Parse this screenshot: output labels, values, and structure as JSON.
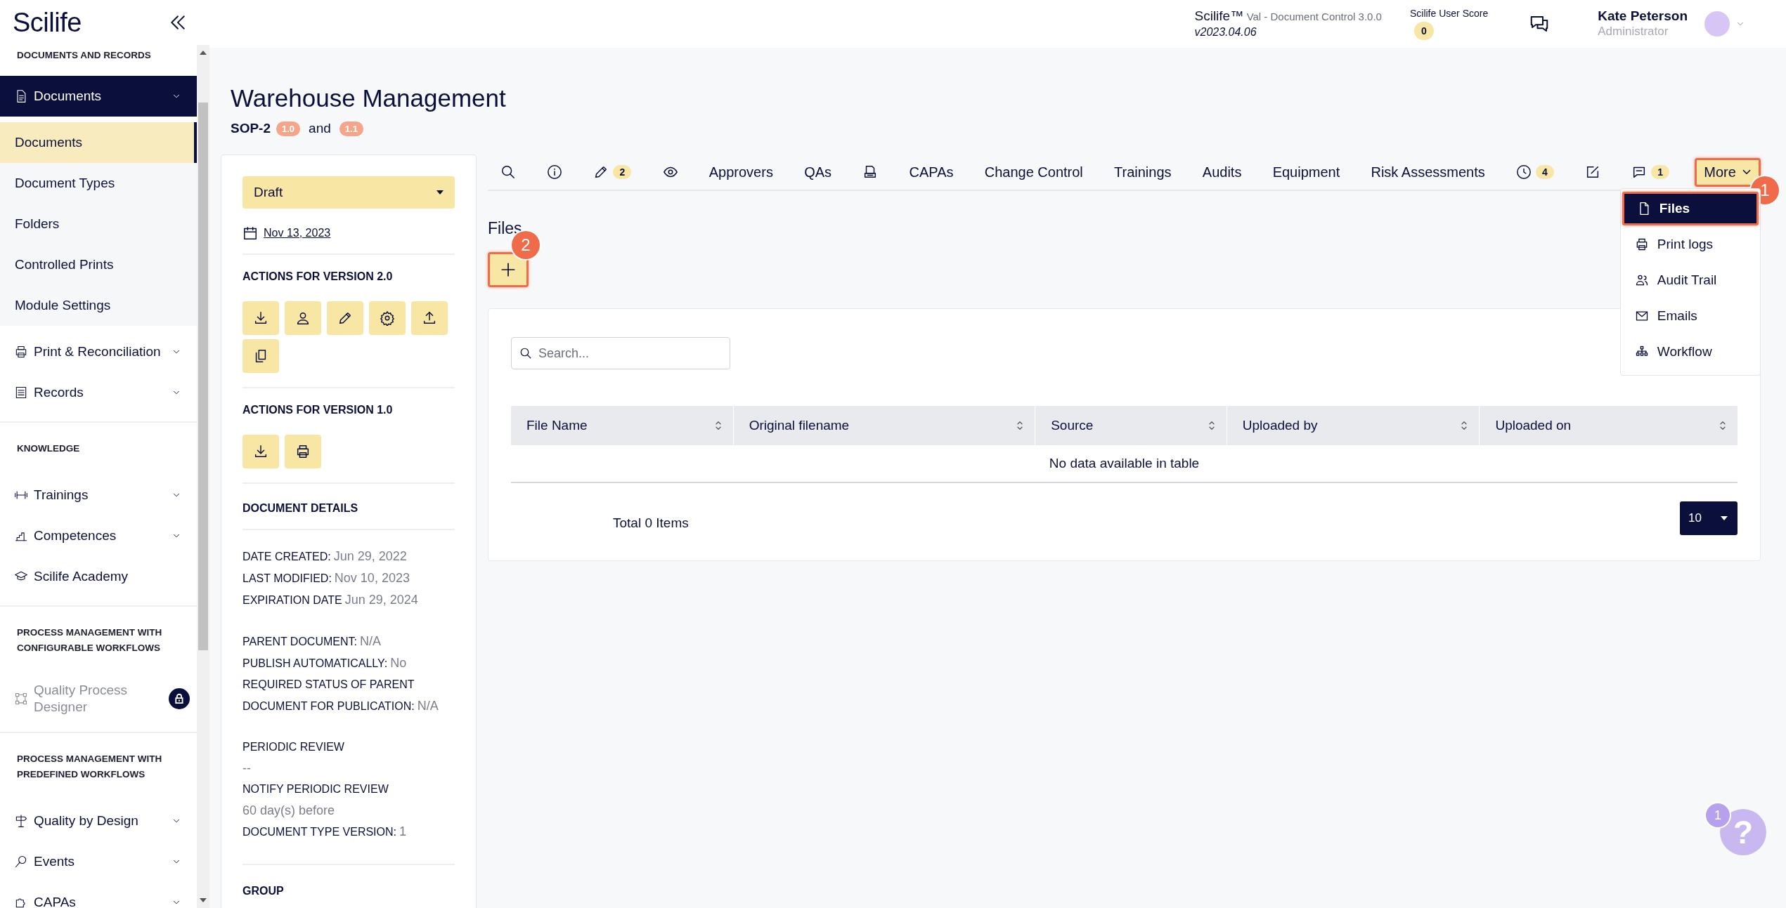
{
  "sidebar": {
    "logo": "Scilife",
    "sections": [
      {
        "title": "DOCUMENTS AND RECORDS",
        "items": [
          {
            "label": "Documents",
            "kind": "group",
            "expanded": true,
            "locked": false,
            "children": [
              {
                "label": "Documents",
                "selected": true
              },
              {
                "label": "Document Types",
                "selected": false
              },
              {
                "label": "Folders",
                "selected": false
              },
              {
                "label": "Controlled Prints",
                "selected": false
              },
              {
                "label": "Module Settings",
                "selected": false
              }
            ]
          },
          {
            "label": "Print & Reconciliation",
            "kind": "group",
            "expanded": false,
            "locked": false
          },
          {
            "label": "Records",
            "kind": "group",
            "expanded": false,
            "locked": false
          }
        ]
      },
      {
        "title": "KNOWLEDGE",
        "items": [
          {
            "label": "Trainings",
            "kind": "group",
            "expanded": false,
            "locked": false
          },
          {
            "label": "Competences",
            "kind": "group",
            "expanded": false,
            "locked": false
          },
          {
            "label": "Scilife Academy",
            "kind": "link",
            "expanded": false,
            "locked": false
          }
        ]
      },
      {
        "title": "PROCESS MANAGEMENT WITH CONFIGURABLE WORKFLOWS",
        "items": [
          {
            "label": "Quality Process Designer",
            "kind": "link",
            "expanded": false,
            "locked": true
          }
        ]
      },
      {
        "title": "PROCESS MANAGEMENT WITH PREDEFINED WORKFLOWS",
        "items": [
          {
            "label": "Quality by Design",
            "kind": "group",
            "expanded": false,
            "locked": false
          },
          {
            "label": "Events",
            "kind": "group",
            "expanded": false,
            "locked": false
          },
          {
            "label": "CAPAs",
            "kind": "group",
            "expanded": false,
            "locked": false
          }
        ]
      }
    ]
  },
  "header": {
    "product": "Scilife™",
    "edition": "Val - Document Control 3.0.0",
    "version": "v2023.04.06",
    "score_label": "Scilife User Score",
    "score": "0",
    "user_name": "Kate Peterson",
    "user_role": "Administrator"
  },
  "page": {
    "title": "Warehouse Management",
    "code": "SOP-2",
    "versions": [
      "1.0",
      "1.1"
    ],
    "joiner": "and"
  },
  "details_panel": {
    "status": "Draft",
    "date": "Nov 13, 2023",
    "action_groups": [
      {
        "title": "ACTIONS FOR VERSION 2.0",
        "buttons": [
          {
            "kind": "download"
          },
          {
            "kind": "user"
          },
          {
            "kind": "pencil"
          },
          {
            "kind": "gear"
          },
          {
            "kind": "upload"
          },
          {
            "kind": "copy"
          }
        ]
      },
      {
        "title": "ACTIONS FOR VERSION 1.0",
        "buttons": [
          {
            "kind": "download"
          },
          {
            "kind": "printer"
          }
        ]
      }
    ],
    "details_title": "DOCUMENT DETAILS",
    "detail_groups": [
      [
        {
          "label": "DATE CREATED:",
          "value": "Jun 29, 2022",
          "kind": "inline"
        },
        {
          "label": "LAST MODIFIED:",
          "value": "Nov 10, 2023",
          "kind": "inline"
        },
        {
          "label": "EXPIRATION DATE",
          "value": "Jun 29, 2024",
          "kind": "inline"
        }
      ],
      [
        {
          "label": "PARENT DOCUMENT:",
          "value": "N/A",
          "kind": "inline"
        },
        {
          "label": "PUBLISH AUTOMATICALLY:",
          "value": "No",
          "kind": "inline"
        },
        {
          "label": "REQUIRED STATUS OF PARENT DOCUMENT FOR PUBLICATION:",
          "value": "N/A",
          "kind": "inline"
        }
      ],
      [
        {
          "label": "PERIODIC REVIEW",
          "value": "--",
          "kind": "block"
        },
        {
          "label": "NOTIFY PERIODIC REVIEW",
          "value": "60 day(s) before",
          "kind": "block"
        },
        {
          "label": "DOCUMENT TYPE VERSION:",
          "value": "1",
          "kind": "inline"
        }
      ]
    ],
    "group_title": "GROUP"
  },
  "tabs": [
    {
      "kind": "search",
      "selected": false,
      "highlighted": false
    },
    {
      "kind": "info",
      "selected": false,
      "highlighted": false
    },
    {
      "kind": "pencil",
      "count": "2",
      "selected": false,
      "highlighted": false
    },
    {
      "kind": "eye",
      "selected": false,
      "highlighted": false
    },
    {
      "kind": "text",
      "label": "Approvers",
      "selected": false,
      "highlighted": false
    },
    {
      "kind": "text",
      "label": "QAs",
      "selected": false,
      "highlighted": false
    },
    {
      "kind": "printdoc",
      "selected": false,
      "highlighted": false
    },
    {
      "kind": "text",
      "label": "CAPAs",
      "selected": false,
      "highlighted": false
    },
    {
      "kind": "text",
      "label": "Change Control",
      "selected": false,
      "highlighted": false
    },
    {
      "kind": "text",
      "label": "Trainings",
      "selected": false,
      "highlighted": false
    },
    {
      "kind": "text",
      "label": "Audits",
      "selected": false,
      "highlighted": false
    },
    {
      "kind": "text",
      "label": "Equipment",
      "selected": false,
      "highlighted": false
    },
    {
      "kind": "text",
      "label": "Risk Assessments",
      "selected": false,
      "highlighted": false
    },
    {
      "kind": "clock",
      "count": "4",
      "selected": false,
      "highlighted": false
    },
    {
      "kind": "editsquare",
      "selected": false,
      "highlighted": false
    },
    {
      "kind": "comment",
      "count": "1",
      "selected": false,
      "highlighted": false
    },
    {
      "kind": "menu",
      "label": "More",
      "selected": true,
      "highlighted": true,
      "callout": "1"
    }
  ],
  "more_menu": {
    "items": [
      {
        "label": "Files",
        "selected": true,
        "highlighted": true
      },
      {
        "label": "Print logs",
        "selected": false,
        "highlighted": false
      },
      {
        "label": "Audit Trail",
        "selected": false,
        "highlighted": false
      },
      {
        "label": "Emails",
        "selected": false,
        "highlighted": false
      },
      {
        "label": "Workflow",
        "selected": false,
        "highlighted": false
      }
    ]
  },
  "files": {
    "heading": "Files",
    "add_button": {
      "highlighted": true,
      "callout": "2"
    },
    "search_placeholder": "Search...",
    "columns": [
      "File Name",
      "Original filename",
      "Source",
      "Uploaded by",
      "Uploaded on"
    ],
    "empty_message": "No data available in table",
    "total": "Total 0 Items",
    "page_size": "10"
  },
  "help": {
    "symbol": "?",
    "badge": "1"
  }
}
